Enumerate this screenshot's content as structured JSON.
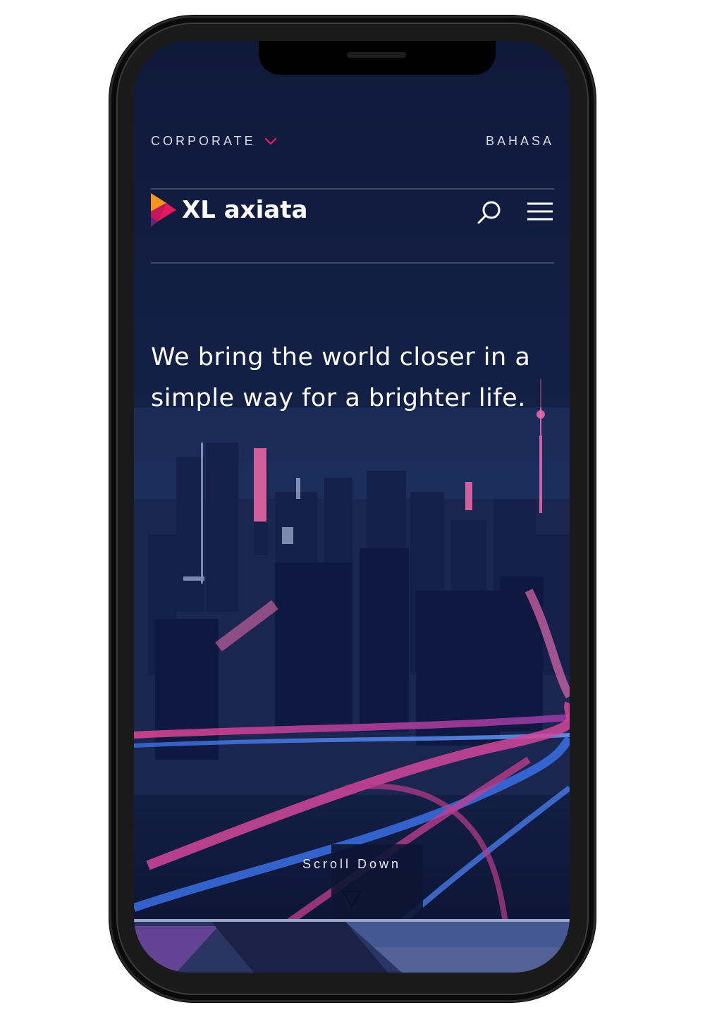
{
  "header": {
    "corporate_label": "CORPORATE",
    "language_label": "BAHASA"
  },
  "brand": {
    "name": "XL axiata",
    "logo_colors": [
      "#f7941d",
      "#e4185b",
      "#6d2077"
    ]
  },
  "hero": {
    "tagline": "We bring the world closer in a simple way for a brighter life.",
    "scroll_label": "Scroll Down"
  },
  "icons": {
    "dropdown": "chevron-down-icon",
    "search": "search-icon",
    "menu": "hamburger-menu-icon",
    "scroll": "triangle-down-icon"
  },
  "colors": {
    "accent": "#e4185b",
    "background": "#0f1a3a",
    "text": "#ffffff"
  }
}
